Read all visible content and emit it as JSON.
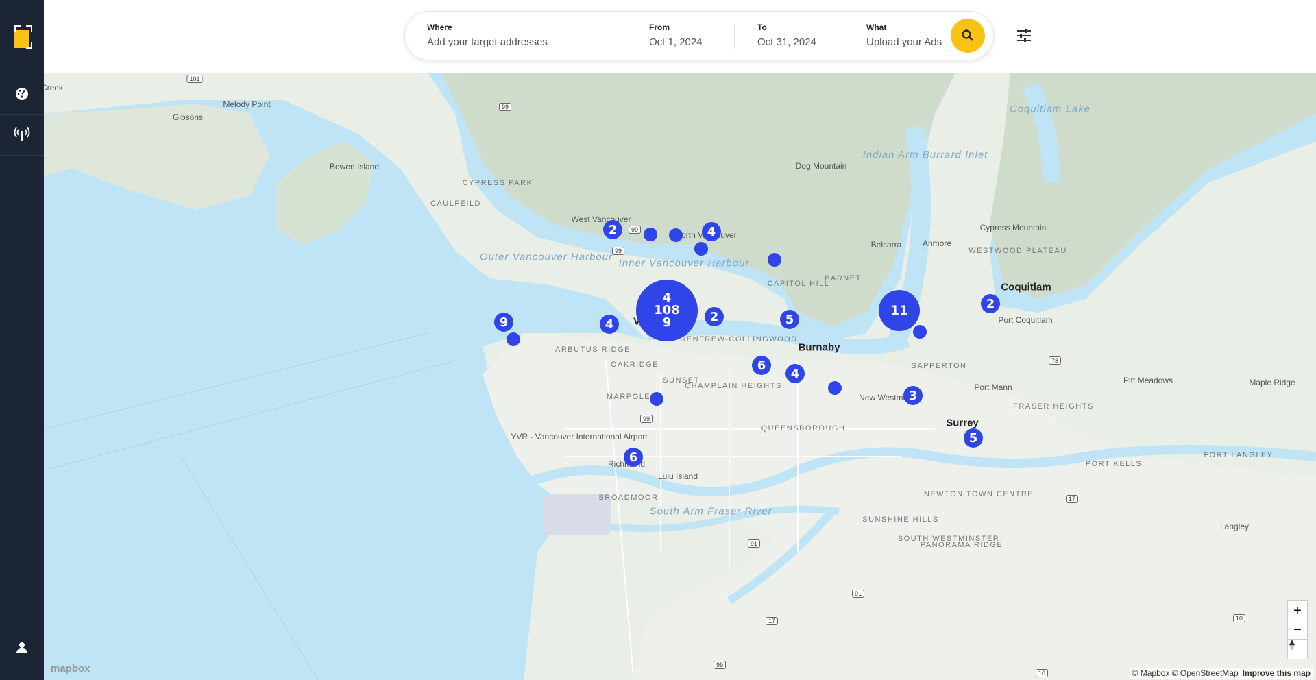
{
  "sidebar": {
    "items": [
      {
        "icon": "dashboard-gauge-icon"
      },
      {
        "icon": "antenna-broadcast-icon"
      }
    ],
    "user_icon": "user-icon"
  },
  "search": {
    "where_label": "Where",
    "where_placeholder": "Add your target addresses",
    "from_label": "From",
    "from_value": "Oct 1, 2024",
    "to_label": "To",
    "to_value": "Oct 31, 2024",
    "what_label": "What",
    "what_value": "Upload your Ads"
  },
  "colors": {
    "accent": "#f9c315",
    "marker": "#2f45e8",
    "sidebar": "#1b2533",
    "water": "#bfe4f6"
  },
  "map": {
    "places": [
      {
        "name": "Langdale",
        "type": "place"
      },
      {
        "name": "Gibsons",
        "type": "place"
      },
      {
        "name": "Melody Point",
        "type": "place"
      },
      {
        "name": "Bowen Island",
        "type": "place"
      },
      {
        "name": "CYPRESS PARK",
        "type": "district"
      },
      {
        "name": "CAULFEILD",
        "type": "district"
      },
      {
        "name": "West Vancouver",
        "type": "place"
      },
      {
        "name": "North Vancouver",
        "type": "place"
      },
      {
        "name": "Outer Vancouver Harbour",
        "type": "water"
      },
      {
        "name": "Inner Vancouver Harbour",
        "type": "water"
      },
      {
        "name": "Dog Mountain",
        "type": "place"
      },
      {
        "name": "Indian Arm Burrard Inlet",
        "type": "water"
      },
      {
        "name": "Coquitlam Lake",
        "type": "water"
      },
      {
        "name": "Cypress Mountain",
        "type": "place"
      },
      {
        "name": "Belcarra",
        "type": "place"
      },
      {
        "name": "Anmore",
        "type": "place"
      },
      {
        "name": "WESTWOOD PLATEAU",
        "type": "district"
      },
      {
        "name": "CAPITOL HILL",
        "type": "district"
      },
      {
        "name": "BARNET",
        "type": "district"
      },
      {
        "name": "Coquitlam",
        "type": "city"
      },
      {
        "name": "Port Coquitlam",
        "type": "place"
      },
      {
        "name": "Vancouver",
        "type": "city"
      },
      {
        "name": "RENFREW-COLLINGWOOD",
        "type": "district"
      },
      {
        "name": "Burnaby",
        "type": "city"
      },
      {
        "name": "ARBUTUS RIDGE",
        "type": "district"
      },
      {
        "name": "OAKRIDGE",
        "type": "district"
      },
      {
        "name": "SUNSET",
        "type": "district"
      },
      {
        "name": "CHAMPLAIN HEIGHTS",
        "type": "district"
      },
      {
        "name": "MARPOLE",
        "type": "district"
      },
      {
        "name": "SAPPERTON",
        "type": "district"
      },
      {
        "name": "New Westminster",
        "type": "place"
      },
      {
        "name": "Port Mann",
        "type": "place"
      },
      {
        "name": "Pitt Meadows",
        "type": "place"
      },
      {
        "name": "Maple Ridge",
        "type": "place"
      },
      {
        "name": "FRASER HEIGHTS",
        "type": "district"
      },
      {
        "name": "YVR - Vancouver International Airport",
        "type": "place"
      },
      {
        "name": "QUEENSBOROUGH",
        "type": "district"
      },
      {
        "name": "Surrey",
        "type": "city"
      },
      {
        "name": "Richmond",
        "type": "place"
      },
      {
        "name": "Lulu Island",
        "type": "place"
      },
      {
        "name": "BROADMOOR",
        "type": "district"
      },
      {
        "name": "South Arm Fraser River",
        "type": "water"
      },
      {
        "name": "NEWTON TOWN CENTRE",
        "type": "district"
      },
      {
        "name": "SUNSHINE HILLS",
        "type": "district"
      },
      {
        "name": "PANORAMA RIDGE",
        "type": "district"
      },
      {
        "name": "PORT KELLS",
        "type": "district"
      },
      {
        "name": "FORT LANGLEY",
        "type": "district"
      },
      {
        "name": "Langley",
        "type": "place"
      },
      {
        "name": "SOUTH WESTMINSTER",
        "type": "district"
      },
      {
        "name": "Creek",
        "type": "place"
      }
    ],
    "highway_shields": [
      "101",
      "99",
      "99",
      "99",
      "99",
      "78",
      "17",
      "91",
      "91",
      "17",
      "99",
      "10",
      "10"
    ],
    "markers": [
      {
        "count": "2"
      },
      {
        "count": ""
      },
      {
        "count": ""
      },
      {
        "count": "4"
      },
      {
        "count": ""
      },
      {
        "count": ""
      },
      {
        "count": "9"
      },
      {
        "count": ""
      },
      {
        "count": "4"
      },
      {
        "count": "4 108 9"
      },
      {
        "count": "2"
      },
      {
        "count": "5"
      },
      {
        "count": "11"
      },
      {
        "count": ""
      },
      {
        "count": "2"
      },
      {
        "count": "6"
      },
      {
        "count": "4"
      },
      {
        "count": ""
      },
      {
        "count": ""
      },
      {
        "count": "3"
      },
      {
        "count": "5"
      },
      {
        "count": "6"
      }
    ],
    "huge_cluster_lines": [
      "4",
      "108",
      "9"
    ],
    "mapbox_logo": "mapbox",
    "attribution": "© Mapbox © OpenStreetMap",
    "improve_link": "Improve this map",
    "zoom_in": "+",
    "zoom_out": "−"
  }
}
